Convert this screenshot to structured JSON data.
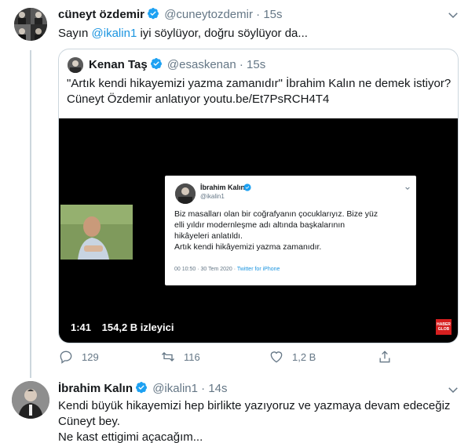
{
  "tweet1": {
    "name": "cüneyt özdemir",
    "handle": "@cuneytozdemir",
    "dot": "·",
    "time": "15s",
    "text_prefix": "Sayın ",
    "mention": "@ikalin1",
    "text_suffix": " iyi söylüyor, doğru söylüyor da...",
    "quote": {
      "name": "Kenan Taş",
      "handle": "@esaskenan",
      "dot": "·",
      "time": "15s",
      "text_line1": "\"Artık kendi hikayemizi yazma zamanıdır\" İbrahim Kalın ne demek istiyor?",
      "text_line2": "Cüneyt Özdemir anlatıyor youtu.be/Et7PsRCH4T4",
      "video": {
        "duration": "1:41",
        "views": "154,2 B izleyici",
        "corner_badge": "HABER GLOB",
        "inner_tweet": {
          "name": "İbrahim Kalın",
          "handle": "@ikalin1",
          "line1": "Biz masalları olan bir coğrafyanın çocuklarıyız. Bize yüz",
          "line2": "elli yıldır modernleşme adı altında başkalarının",
          "line3": "hikâyeleri anlatıldı.",
          "line4": "Artık kendi hikâyemizi yazma zamanıdır.",
          "meta_time": "00 10:50 · 30 Tem 2020 · ",
          "meta_source": "Twitter for iPhone"
        }
      }
    },
    "actions": {
      "reply_count": "129",
      "retweet_count": "116",
      "like_count": "1,2 B"
    }
  },
  "tweet2": {
    "name": "İbrahim Kalın",
    "handle": "@ikalin1",
    "dot": "·",
    "time": "14s",
    "line1": "Kendi büyük hikayemizi hep birlikte yazıyoruz ve yazmaya devam edeceğiz",
    "line2": "Cüneyt bey.",
    "line3": "Ne kast ettigimi açacağım..."
  },
  "colors": {
    "link": "#1b95e0",
    "verified": "#1da1f2",
    "muted": "#657786",
    "border": "#ccd6dd"
  }
}
